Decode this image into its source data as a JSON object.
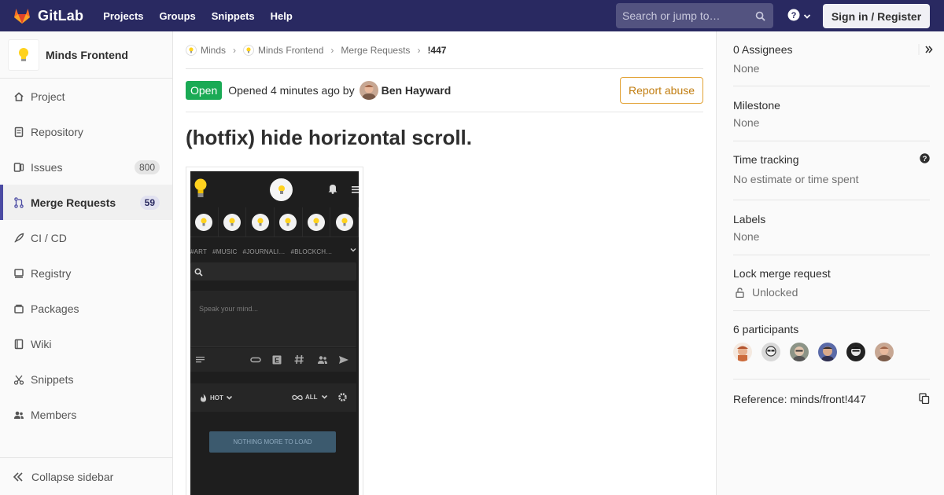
{
  "topnav": {
    "brand": "GitLab",
    "links": [
      "Projects",
      "Groups",
      "Snippets",
      "Help"
    ],
    "search_placeholder": "Search or jump to…",
    "signin_label": "Sign in / Register",
    "bg_color": "#292961"
  },
  "sidebar": {
    "project_name": "Minds Frontend",
    "items": [
      {
        "label": "Project",
        "icon": "home-icon"
      },
      {
        "label": "Repository",
        "icon": "doc-icon"
      },
      {
        "label": "Issues",
        "icon": "issues-icon",
        "count": "800"
      },
      {
        "label": "Merge Requests",
        "icon": "merge-request-icon",
        "count": "59",
        "active": true
      },
      {
        "label": "CI / CD",
        "icon": "rocket-icon"
      },
      {
        "label": "Registry",
        "icon": "registry-icon"
      },
      {
        "label": "Packages",
        "icon": "package-icon"
      },
      {
        "label": "Wiki",
        "icon": "book-icon"
      },
      {
        "label": "Snippets",
        "icon": "scissors-icon"
      },
      {
        "label": "Members",
        "icon": "users-icon"
      }
    ],
    "collapse_label": "Collapse sidebar"
  },
  "breadcrumb": [
    "Minds",
    "Minds Frontend",
    "Merge Requests",
    "!447"
  ],
  "mr": {
    "status": "Open",
    "opened_text": "Opened 4 minutes ago by",
    "author": "Ben Hayward",
    "report_label": "Report abuse",
    "title": "(hotfix) hide horizontal scroll.",
    "status_color": "#1aaa55"
  },
  "screenshot": {
    "tags": [
      "#ART",
      "#MUSIC",
      "#JOURNALI…",
      "#BLOCKCH…"
    ],
    "compose_placeholder": "Speak your mind...",
    "sort_hot": "HOT",
    "sort_all": "ALL",
    "load_label": "NOTHING MORE TO LOAD"
  },
  "right_sidebar": {
    "assignees_label": "0 Assignees",
    "assignees_value": "None",
    "milestone_label": "Milestone",
    "milestone_value": "None",
    "time_label": "Time tracking",
    "time_value": "No estimate or time spent",
    "labels_label": "Labels",
    "labels_value": "None",
    "lock_label": "Lock merge request",
    "lock_value": "Unlocked",
    "participants_label": "6 participants",
    "reference_text": "Reference: minds/front!447"
  }
}
